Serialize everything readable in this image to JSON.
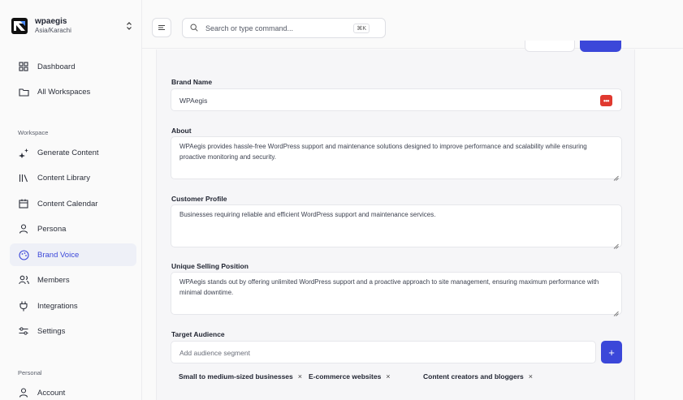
{
  "workspace": {
    "name": "wpaegis",
    "timezone": "Asia/Karachi"
  },
  "nav": {
    "dashboard": "Dashboard",
    "all_workspaces": "All Workspaces",
    "section_workspace": "Workspace",
    "generate_content": "Generate Content",
    "content_library": "Content Library",
    "content_calendar": "Content Calendar",
    "persona": "Persona",
    "brand_voice": "Brand Voice",
    "members": "Members",
    "integrations": "Integrations",
    "settings": "Settings",
    "section_personal": "Personal",
    "account": "Account"
  },
  "search": {
    "placeholder": "Search or type command...",
    "shortcut": "⌘K"
  },
  "form": {
    "brand_name": {
      "label": "Brand Name",
      "value": "WPAegis"
    },
    "about": {
      "label": "About",
      "value": "WPAegis provides hassle-free WordPress support and maintenance solutions designed to improve performance and scalability while ensuring proactive monitoring and security."
    },
    "customer_profile": {
      "label": "Customer Profile",
      "value": "Businesses requiring reliable and efficient WordPress support and maintenance services."
    },
    "usp": {
      "label": "Unique Selling Position",
      "value": "WPAegis stands out by offering unlimited WordPress support and a proactive approach to site management, ensuring maximum performance with minimal downtime."
    },
    "target_audience": {
      "label": "Target Audience",
      "placeholder": "Add audience segment",
      "add_label": "+",
      "segments": [
        "Small to medium-sized businesses",
        "E-commerce websites",
        "Content creators and bloggers"
      ],
      "remove_label": "×"
    }
  },
  "colors": {
    "accent": "#3b47d9",
    "active_bg": "#eef0f7",
    "password_icon": "#e0392f"
  }
}
